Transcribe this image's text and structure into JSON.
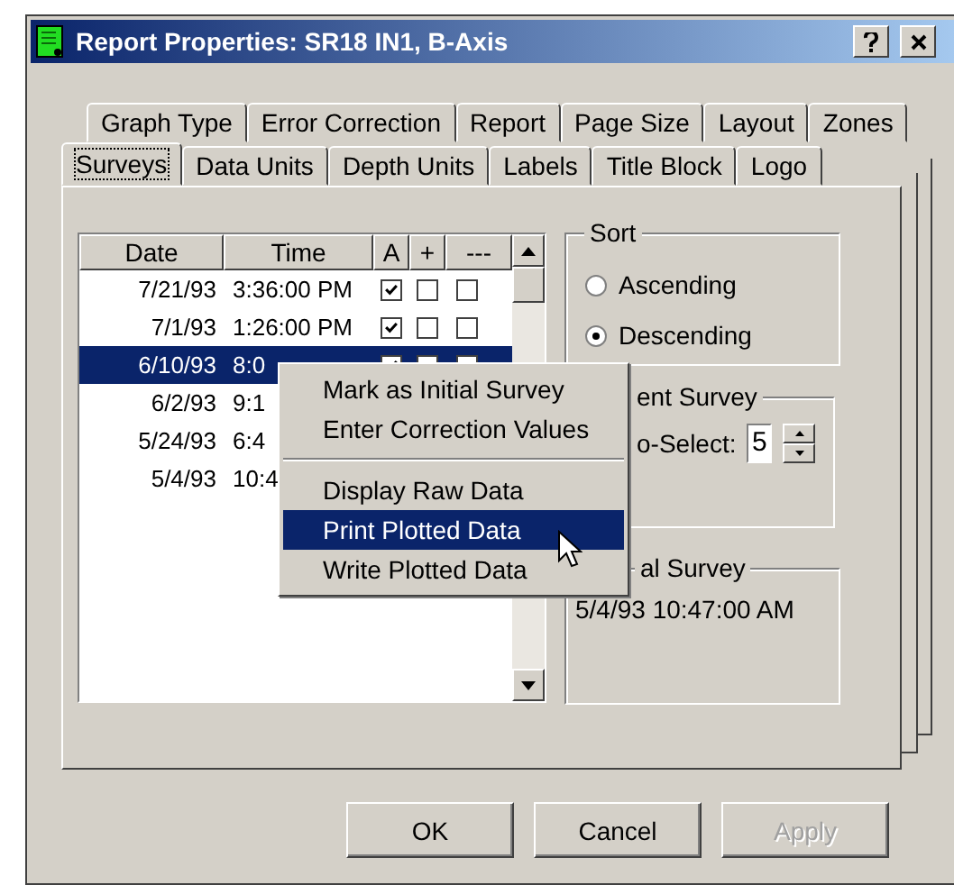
{
  "window": {
    "title": "Report Properties: SR18 IN1, B-Axis"
  },
  "tab_rows": [
    [
      {
        "label": "Graph Type",
        "selected": false
      },
      {
        "label": "Error Correction",
        "selected": false
      },
      {
        "label": "Report",
        "selected": false
      },
      {
        "label": "Page Size",
        "selected": false
      },
      {
        "label": "Layout",
        "selected": false
      },
      {
        "label": "Zones",
        "selected": false
      }
    ],
    [
      {
        "label": "Surveys",
        "selected": true
      },
      {
        "label": "Data Units",
        "selected": false
      },
      {
        "label": "Depth Units",
        "selected": false
      },
      {
        "label": "Labels",
        "selected": false
      },
      {
        "label": "Title Block",
        "selected": false
      },
      {
        "label": "Logo",
        "selected": false
      }
    ]
  ],
  "survey_list": {
    "columns": [
      "Date",
      "Time",
      "A",
      "+",
      "---"
    ],
    "rows": [
      {
        "date": "7/21/93",
        "time": "3:36:00 PM",
        "selected": false,
        "checks": [
          true,
          false,
          false
        ]
      },
      {
        "date": "7/1/93",
        "time": "1:26:00 PM",
        "selected": false,
        "checks": [
          true,
          false,
          false
        ]
      },
      {
        "date": "6/10/93",
        "time": "8:0",
        "selected": true,
        "checks": [
          true,
          false,
          false
        ]
      },
      {
        "date": "6/2/93",
        "time": "9:1",
        "selected": false
      },
      {
        "date": "5/24/93",
        "time": "6:4",
        "selected": false
      },
      {
        "date": "5/4/93",
        "time": "10:4",
        "selected": false
      }
    ]
  },
  "sort": {
    "title": "Sort",
    "options": [
      {
        "label": "Ascending",
        "selected": false
      },
      {
        "label": "Descending",
        "selected": true
      }
    ]
  },
  "current_survey": {
    "title": "ent Survey",
    "label": "o-Select:",
    "value": "5"
  },
  "initial_survey": {
    "title": "al Survey",
    "value": "5/4/93 10:47:00 AM"
  },
  "context_menu": [
    {
      "kind": "item",
      "label": "Mark as Initial Survey",
      "selected": false
    },
    {
      "kind": "item",
      "label": "Enter Correction Values",
      "selected": false
    },
    {
      "kind": "separator"
    },
    {
      "kind": "item",
      "label": "Display Raw Data",
      "selected": false
    },
    {
      "kind": "item",
      "label": "Print Plotted Data",
      "selected": true
    },
    {
      "kind": "item",
      "label": "Write Plotted Data",
      "selected": false
    }
  ],
  "buttons": [
    {
      "label": "OK",
      "disabled": false
    },
    {
      "label": "Cancel",
      "disabled": false
    },
    {
      "label": "Apply",
      "disabled": true
    }
  ]
}
